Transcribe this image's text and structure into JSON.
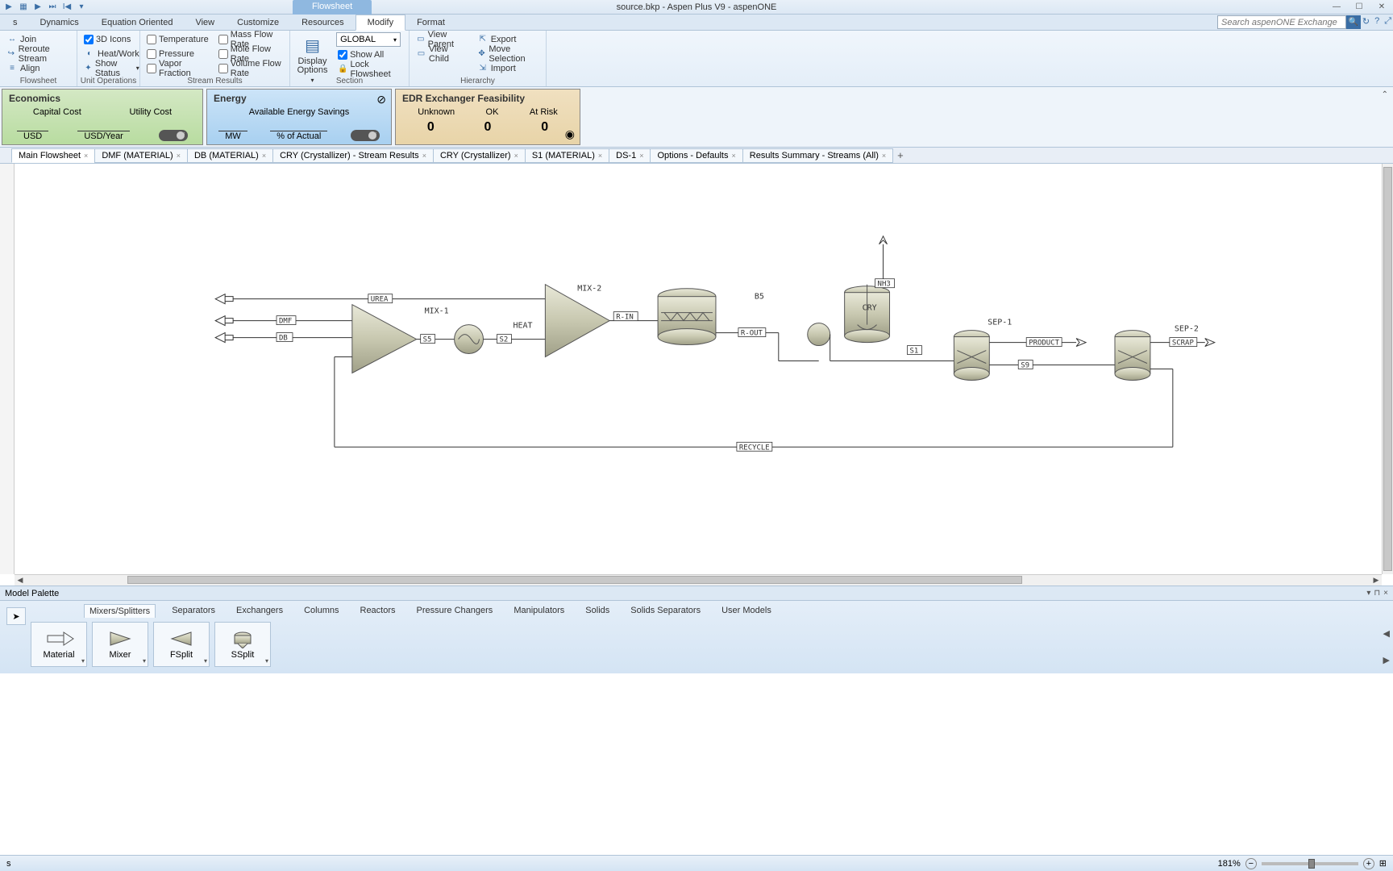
{
  "window": {
    "title": "source.bkp - Aspen Plus V9 - aspenONE",
    "context_tab": "Flowsheet"
  },
  "search": {
    "placeholder": "Search aspenONE Exchange"
  },
  "ribbon_tabs": [
    "s",
    "Dynamics",
    "Equation Oriented",
    "View",
    "Customize",
    "Resources",
    "Modify",
    "Format"
  ],
  "ribbon_active": "Modify",
  "ribbon": {
    "flowsheet_group": {
      "join": "Join",
      "reroute": "Reroute Stream",
      "align": "Align",
      "label": "Flowsheet"
    },
    "unitops_group": {
      "icons3d": "3D Icons",
      "heatwork": "Heat/Work",
      "showstatus": "Show Status",
      "label": "Unit Operations"
    },
    "streamres_group": {
      "temperature": "Temperature",
      "pressure": "Pressure",
      "vaporfrac": "Vapor Fraction",
      "massflow": "Mass Flow Rate",
      "moleflow": "Mole Flow Rate",
      "volflow": "Volume Flow Rate",
      "label": "Stream Results"
    },
    "section_group": {
      "display": "Display Options",
      "scope": "GLOBAL",
      "showall": "Show All",
      "lock": "Lock Flowsheet",
      "label": "Section"
    },
    "hierarchy_group": {
      "viewparent": "View Parent",
      "viewchild": "View Child",
      "export": "Export",
      "movesel": "Move Selection",
      "import": "Import",
      "label": "Hierarchy"
    }
  },
  "kpi": {
    "economics": {
      "title": "Economics",
      "c1": "Capital Cost",
      "c2": "Utility Cost",
      "u1": "USD",
      "u2": "USD/Year",
      "toggle": "off"
    },
    "energy": {
      "title": "Energy",
      "sub": "Available Energy Savings",
      "u1": "MW",
      "u2": "% of Actual",
      "toggle": "off"
    },
    "edr": {
      "title": "EDR Exchanger Feasibility",
      "c1": "Unknown",
      "c2": "OK",
      "c3": "At Risk",
      "v1": "0",
      "v2": "0",
      "v3": "0"
    }
  },
  "doc_tabs": [
    "Main Flowsheet",
    "DMF (MATERIAL)",
    "DB (MATERIAL)",
    "CRY (Crystallizer) - Stream Results",
    "CRY (Crystallizer)",
    "S1 (MATERIAL)",
    "DS-1",
    "Options - Defaults",
    "Results Summary - Streams (All)"
  ],
  "doc_active": "Main Flowsheet",
  "flowsheet": {
    "streams": {
      "urea": "UREA",
      "dmf": "DMF",
      "db": "DB",
      "s5": "S5",
      "s2": "S2",
      "heat": "HEAT",
      "rin": "R-IN",
      "rout": "R-OUT",
      "nh3": "NH3",
      "s1": "S1",
      "product": "PRODUCT",
      "s9": "S9",
      "scrap": "SCRAP",
      "recycle": "RECYCLE"
    },
    "blocks": {
      "mix1": "MIX-1",
      "mix2": "MIX-2",
      "b5": "B5",
      "cry": "CRY",
      "sep1": "SEP-1",
      "sep2": "SEP-2"
    }
  },
  "palette": {
    "title": "Model Palette",
    "categories": [
      "Mixers/Splitters",
      "Separators",
      "Exchangers",
      "Columns",
      "Reactors",
      "Pressure Changers",
      "Manipulators",
      "Solids",
      "Solids Separators",
      "User Models"
    ],
    "cat_active": "Mixers/Splitters",
    "items": {
      "material": "Material",
      "mixer": "Mixer",
      "fsplit": "FSplit",
      "ssplit": "SSplit"
    }
  },
  "status": {
    "left": "s",
    "zoom": "181%"
  }
}
